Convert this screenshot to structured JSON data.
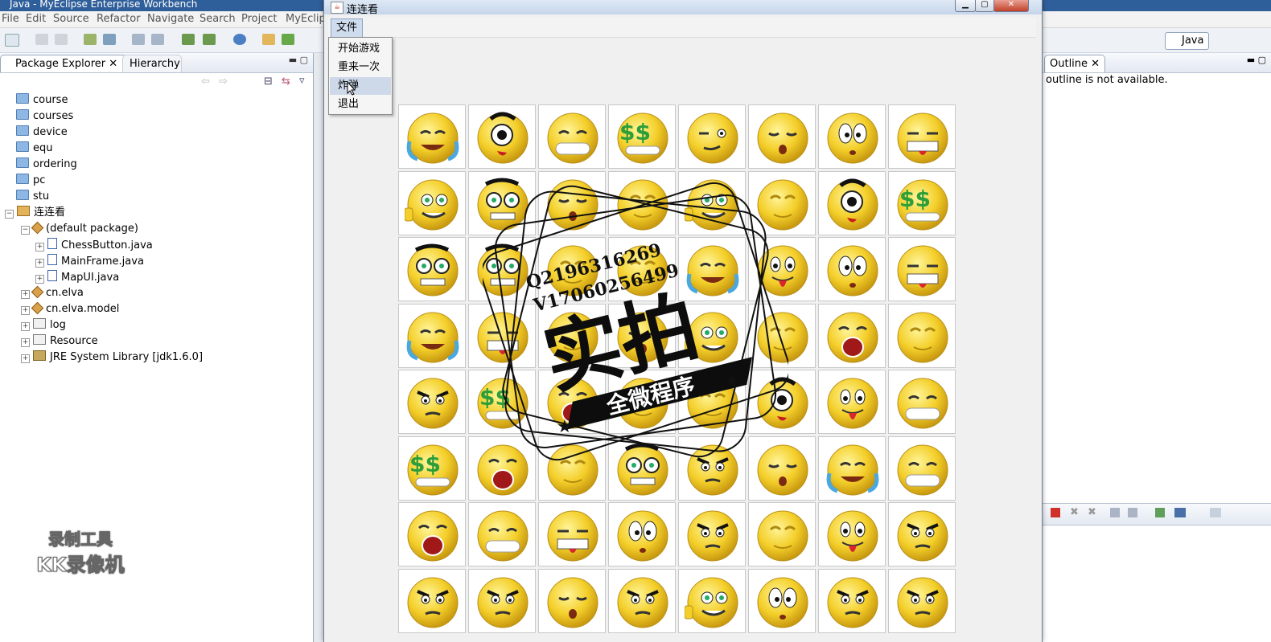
{
  "ide": {
    "title": "Java - MyEclipse Enterprise Workbench",
    "menus": [
      "File",
      "Edit",
      "Source",
      "Refactor",
      "Navigate",
      "Search",
      "Project",
      "MyEclip"
    ],
    "perspective": "Java"
  },
  "package_explorer": {
    "tab_label": "Package Explorer",
    "hierarchy_tab": "Hierarchy",
    "items": [
      {
        "label": "course",
        "icon": "folder-icon"
      },
      {
        "label": "courses",
        "icon": "folder-icon"
      },
      {
        "label": "device",
        "icon": "folder-icon"
      },
      {
        "label": "equ",
        "icon": "folder-icon"
      },
      {
        "label": "ordering",
        "icon": "folder-icon"
      },
      {
        "label": "pc",
        "icon": "folder-icon"
      },
      {
        "label": "stu",
        "icon": "folder-icon"
      },
      {
        "label": "连连看",
        "icon": "project-icon"
      },
      {
        "label": "(default package)",
        "icon": "package-icon"
      },
      {
        "label": "ChessButton.java",
        "icon": "java-file-icon"
      },
      {
        "label": "MainFrame.java",
        "icon": "java-file-icon"
      },
      {
        "label": "MapUI.java",
        "icon": "java-file-icon"
      },
      {
        "label": "cn.elva",
        "icon": "package-icon"
      },
      {
        "label": "cn.elva.model",
        "icon": "package-icon"
      },
      {
        "label": "log",
        "icon": "source-folder-icon"
      },
      {
        "label": "Resource",
        "icon": "source-folder-icon"
      },
      {
        "label": "JRE System Library [jdk1.6.0]",
        "icon": "library-icon"
      }
    ]
  },
  "outline": {
    "tab_label": "Outline",
    "message": "outline is not available."
  },
  "game": {
    "title": "连连看",
    "menu_file": "文件",
    "file_menu_items": [
      "开始游戏",
      "重来一次",
      "炸弹",
      "退出"
    ],
    "board_rows": [
      [
        "crying-laugh",
        "one-eye",
        "grin-closed",
        "dollar",
        "wink",
        "sleepy",
        "worried",
        "sweat-teeth"
      ],
      [
        "thumbs-up",
        "nerd",
        "sleepy",
        "smile-closed",
        "thumbs-up",
        "smile-closed",
        "one-eye",
        "dollar"
      ],
      [
        "nerd",
        "nerd",
        "smile-closed",
        "smile-closed",
        "crying-laugh",
        "tongue",
        "worried",
        "sweat-teeth"
      ],
      [
        "crying-laugh",
        "sweat-teeth",
        "smile-closed",
        "sleepy",
        "thumbs-up",
        "smile-closed",
        "shout",
        "smile-closed"
      ],
      [
        "angry",
        "dollar",
        "shout",
        "smile-closed",
        "smile-closed",
        "one-eye",
        "tongue",
        "grin-closed"
      ],
      [
        "dollar",
        "shout",
        "smile-closed",
        "nerd",
        "angry",
        "sleepy",
        "crying-laugh",
        "grin-closed"
      ],
      [
        "shout",
        "grin-closed",
        "sweat-teeth",
        "worried",
        "angry",
        "smile-closed",
        "tongue",
        "angry"
      ],
      [
        "angry",
        "angry",
        "sleepy",
        "angry",
        "thumbs-up",
        "worried",
        "angry",
        "angry"
      ]
    ]
  },
  "watermark": {
    "qq": "Q2196316269",
    "wechat": "V17060256499",
    "big": "实拍",
    "banner": "全微程序",
    "recorder_line1": "录制工具",
    "recorder_line2": "KK录像机"
  },
  "colors": {
    "emoji_yellow": "#f4cf2a",
    "title_bar": "#2f5f9a",
    "dropdown_highlight": "#cdd9e9"
  }
}
